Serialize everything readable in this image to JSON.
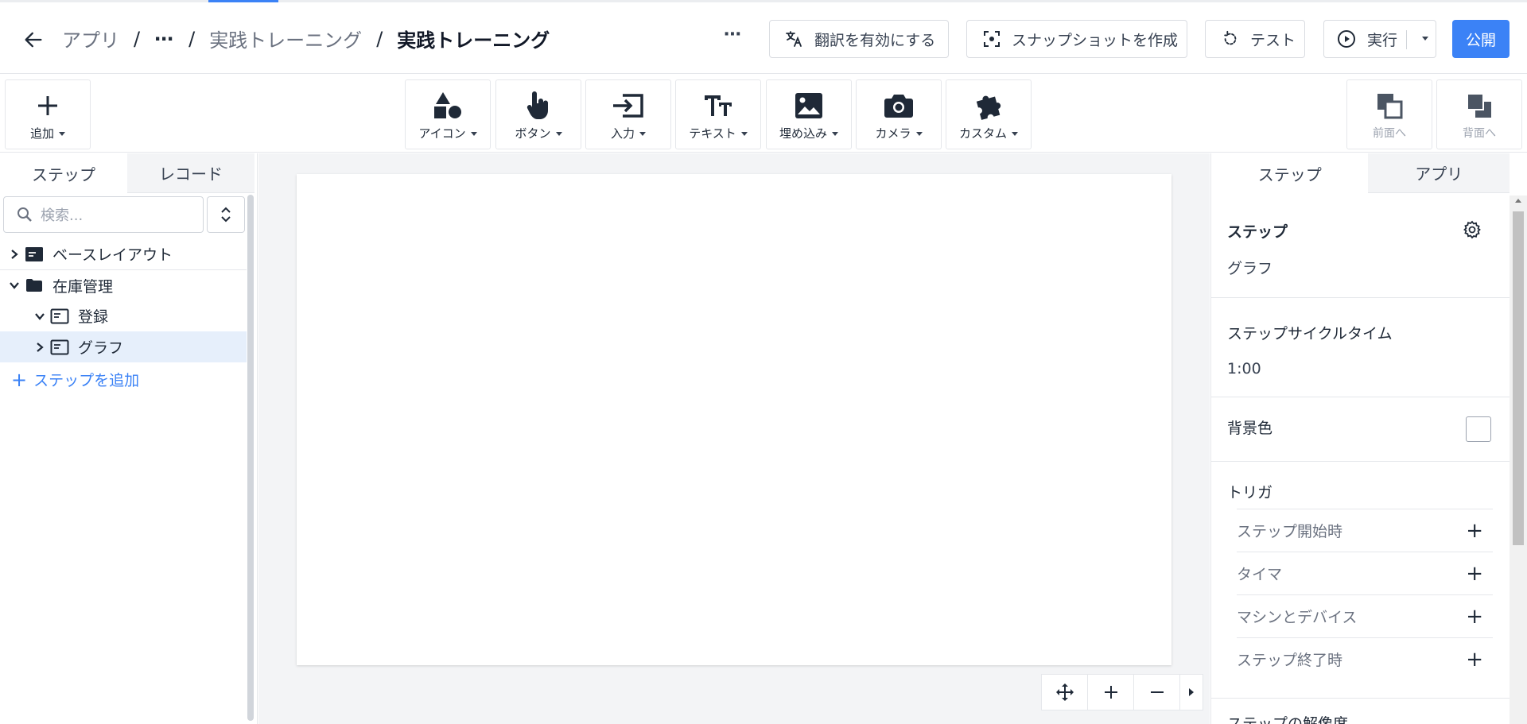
{
  "header": {
    "breadcrumbs": [
      "アプリ",
      "⋯",
      "実践トレーニング",
      "実践トレーニング"
    ],
    "more": "⋯",
    "translate_label": "翻訳を有効にする",
    "snapshot_label": "スナップショットを作成",
    "test_label": "テスト",
    "run_label": "実行",
    "publish_label": "公開"
  },
  "toolbar": {
    "add_label": "追加",
    "tools": [
      "アイコン",
      "ボタン",
      "入力",
      "テキスト",
      "埋め込み",
      "カメラ",
      "カスタム"
    ],
    "front_label": "前面へ",
    "back_label": "背面へ"
  },
  "left_panel": {
    "tabs": [
      "ステップ",
      "レコード"
    ],
    "search_placeholder": "検索...",
    "tree": {
      "base_layout": "ベースレイアウト",
      "folder": "在庫管理",
      "register": "登録",
      "graph": "グラフ"
    },
    "add_step": "ステップを追加"
  },
  "right_panel": {
    "tabs": [
      "ステップ",
      "アプリ"
    ],
    "step_heading": "ステップ",
    "step_name": "グラフ",
    "cycle_time_label": "ステップサイクルタイム",
    "cycle_time_value": "1:00",
    "bg_color_label": "背景色",
    "trigger_label": "トリガ",
    "triggers": [
      "ステップ開始時",
      "タイマ",
      "マシンとデバイス",
      "ステップ終了時"
    ],
    "resolution_label": "ステップの解像度"
  },
  "colors": {
    "accent": "#3b82f6",
    "selected_row": "#e6effb"
  }
}
